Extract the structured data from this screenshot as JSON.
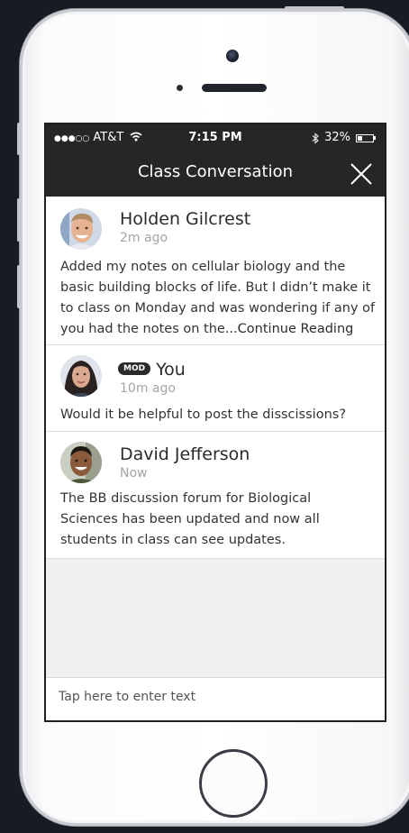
{
  "status_bar": {
    "carrier": "AT&T",
    "time": "7:15 PM",
    "battery_percent": "32%",
    "battery_level": 0.32
  },
  "nav": {
    "title": "Class Conversation"
  },
  "messages": [
    {
      "author": "Holden Gilcrest",
      "time": "2m ago",
      "text": "Added my notes on cellular biology and the basic building blocks of life. But I didn’t make it to class on Monday and was wondering if any of you had the notes on the...",
      "more_link": "Continue Reading"
    },
    {
      "badge": "MOD",
      "author": "You",
      "time": "10m ago",
      "text": "Would it be helpful to post the disscissions?"
    },
    {
      "author": "David Jefferson",
      "time": "Now",
      "text": "The BB discussion forum for Biological Sciences has been updated and now all students in class can see updates."
    }
  ],
  "composer": {
    "placeholder": "Tap here to enter text"
  },
  "colors": {
    "bar": "#262626",
    "background": "#171b24"
  }
}
